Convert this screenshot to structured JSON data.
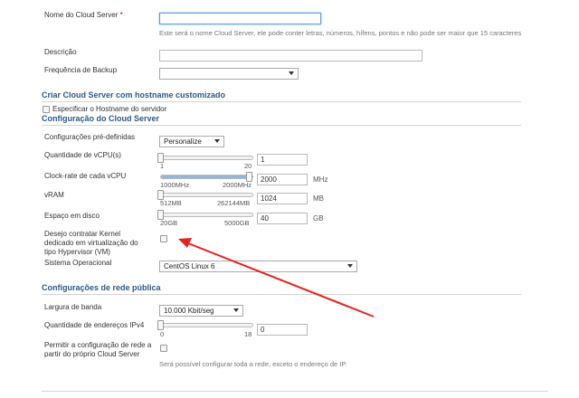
{
  "fields": {
    "server_name": {
      "label": "Nome do Cloud Server",
      "required_mark": "*",
      "value": "",
      "hint": "Este será o nome Cloud Server, ele pode conter letras, números, hífens, pontos e não pode ser maior que 15 caracteres"
    },
    "description": {
      "label": "Descrição",
      "value": ""
    },
    "backup": {
      "label": "Frequência de Backup",
      "value": ""
    }
  },
  "hostname_section": {
    "title": "Criar Cloud Server com hostname customizado",
    "checkbox_label": "Especificar o Hostname do servidor",
    "checked": false
  },
  "config_section": {
    "title": "Configuração do Cloud Server",
    "presets": {
      "label": "Configurações pré-definidas",
      "value": "Personalize"
    },
    "vcpu": {
      "label": "Quantidade de vCPU(s)",
      "min": "1",
      "max": "20",
      "value": "1",
      "level": 0.0
    },
    "clock": {
      "label": "Clock-rate de cada vCPU",
      "min": "1000MHz",
      "max": "2000MHz",
      "value": "2000",
      "unit": "MHz",
      "level": 1.0
    },
    "vram": {
      "label": "vRAM",
      "min": "512MB",
      "max": "262144MB",
      "value": "1024",
      "unit": "MB",
      "level": 0.0
    },
    "disk": {
      "label": "Espaço em disco",
      "min": "20GB",
      "max": "5000GB",
      "value": "40",
      "unit": "GB",
      "level": 0.0
    },
    "hypervisor": {
      "label": "Desejo contratar Kernel dedicado em virtualização do tipo Hypervisor (VM)",
      "checked": false
    },
    "os": {
      "label": "Sistema Operacional",
      "value": "CentOS Linux 6"
    }
  },
  "network_section": {
    "title": "Configurações de rede pública",
    "bandwidth": {
      "label": "Largura de banda",
      "value": "10.000 Kbit/seg"
    },
    "ipv4": {
      "label": "Quantidade de endereços IPv4",
      "min": "0",
      "max": "18",
      "value": "0",
      "level": 0.0
    },
    "self_config": {
      "label": "Permitir a configuração de rede a partir do próprio Cloud Server",
      "checked": false,
      "hint": "Será possível configurar toda a rede, exceto o endereço de IP."
    }
  },
  "annotation": {
    "arrow_color": "#e8221d"
  }
}
